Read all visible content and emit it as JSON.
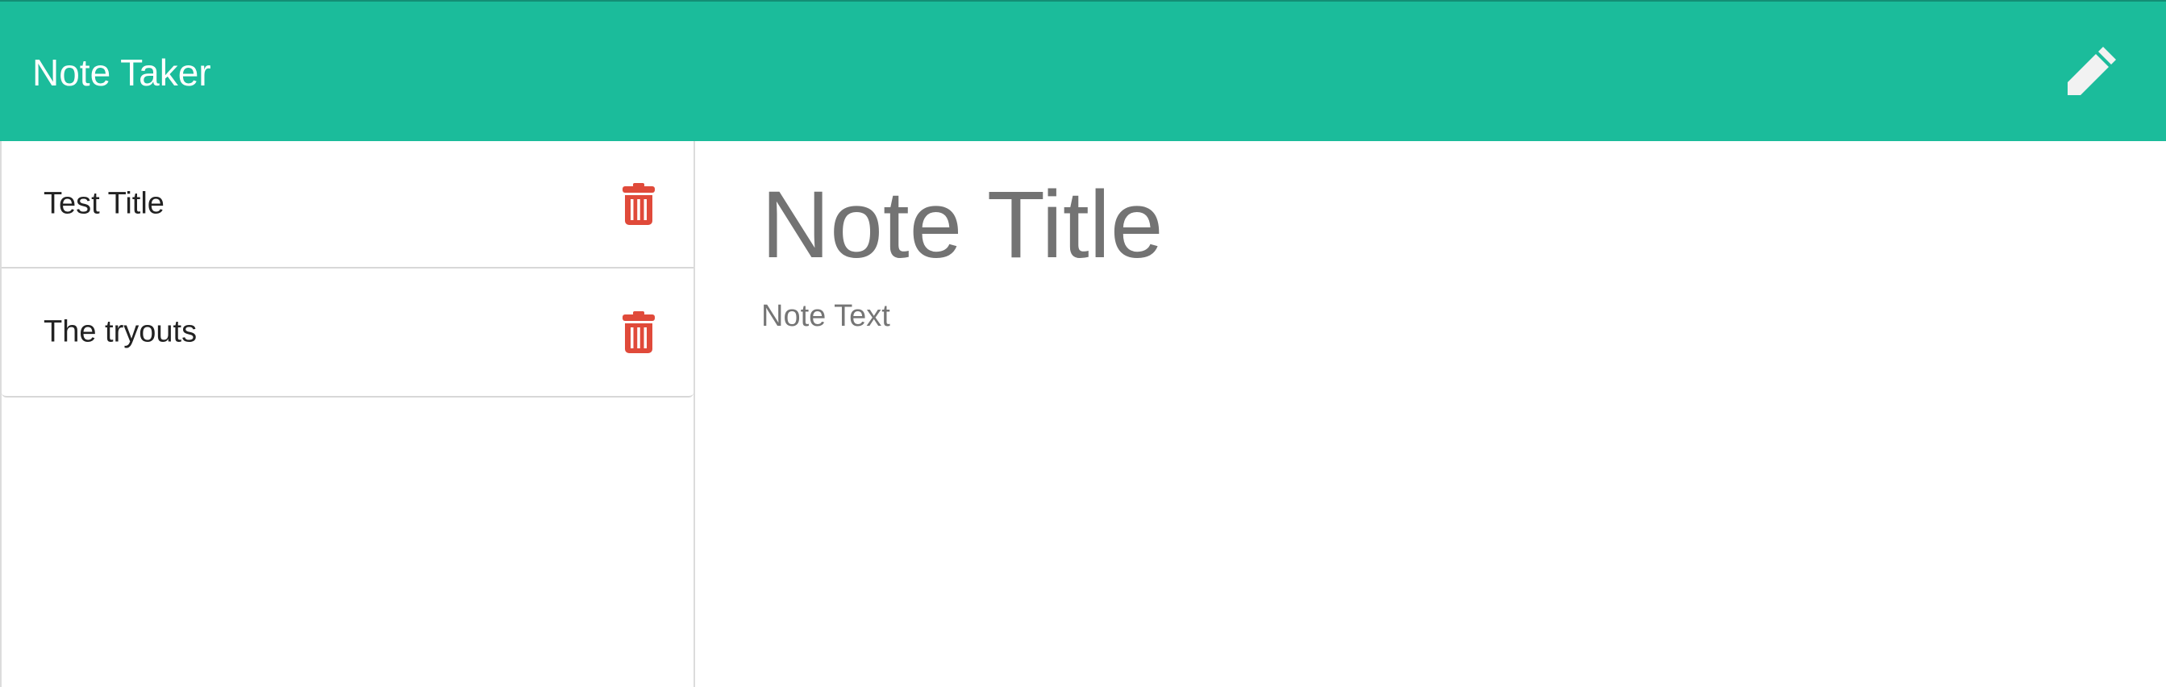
{
  "navbar": {
    "brand": "Note Taker",
    "new_note_icon": "pencil-icon",
    "background_color": "#1bbc9b"
  },
  "sidebar": {
    "notes": [
      {
        "title": "Test Title",
        "delete_icon": "trash-icon"
      },
      {
        "title": "The tryouts",
        "delete_icon": "trash-icon"
      }
    ],
    "delete_icon_color": "#e04a3a"
  },
  "editor": {
    "title_placeholder": "Note Title",
    "text_placeholder": "Note Text"
  }
}
